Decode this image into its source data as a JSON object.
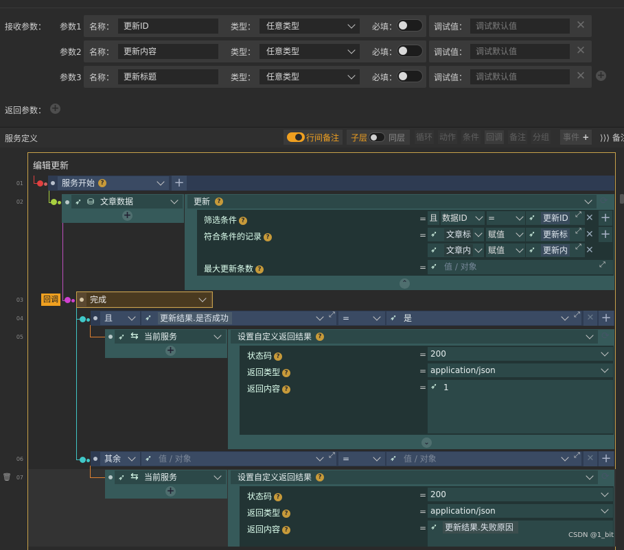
{
  "labels": {
    "receive": "接收参数：",
    "return": "返回参数：",
    "service_def": "服务定义"
  },
  "params": [
    {
      "idx": "参数1",
      "name_label": "名称：",
      "name": "更新ID",
      "type_label": "类型：",
      "type": "任意类型",
      "required_label": "必填：",
      "debug_label": "调试值：",
      "debug_ph": "调试默认值"
    },
    {
      "idx": "参数2",
      "name_label": "名称：",
      "name": "更新内容",
      "type_label": "类型：",
      "type": "任意类型",
      "required_label": "必填：",
      "debug_label": "调试值：",
      "debug_ph": "调试默认值"
    },
    {
      "idx": "参数3",
      "name_label": "名称：",
      "name": "更新标题",
      "type_label": "类型：",
      "type": "任意类型",
      "required_label": "必填：",
      "debug_label": "调试值：",
      "debug_ph": "调试默认值"
    }
  ],
  "toolbar": {
    "line_note": "行间备注",
    "child": "子层",
    "sibling": "同层",
    "loop": "循环",
    "action": "动作",
    "cond": "条件",
    "callback": "回调",
    "note": "备注",
    "group": "分组",
    "event": "事件",
    "note2": "备注"
  },
  "flow": {
    "title": "编辑更新",
    "lines": [
      "01",
      "02",
      "03",
      "04",
      "05",
      "06",
      "07"
    ],
    "start": "服务开始",
    "article": "文章数据",
    "update": "更新",
    "filter": "筛选条件",
    "filter_and": "且",
    "filter_field": "数据ID",
    "filter_op": "=",
    "filter_val": "更新ID",
    "records": "符合条件的记录",
    "rec1_field": "文章标",
    "rec1_op": "赋值",
    "rec1_val": "更新标",
    "rec2_field": "文章内",
    "rec2_op": "赋值",
    "rec2_val": "更新内",
    "maxcount": "最大更新条数",
    "value_ph": "值 / 对象",
    "callback_tag": "回调",
    "done": "完成",
    "and": "且",
    "cond_expr": "更新结果.是否成功",
    "eq": "=",
    "yes": "是",
    "cur_service": "当前服务",
    "set_result": "设置自定义返回结果",
    "status_code": "状态码",
    "status_val": "200",
    "ret_type": "返回类型",
    "ret_type_val": "application/json",
    "ret_content": "返回内容",
    "ret_content_val": "1",
    "else": "其余",
    "else_ph": "值 / 对象",
    "ret_content2": "更新结果.失败原因",
    "equals": "="
  },
  "watermark": "CSDN @1_bit",
  "colors": {
    "accent": "#f0a020",
    "frame": "#c9a24a",
    "start_dot": "#e04040",
    "green_dot": "#a8d040",
    "purple_dot": "#d040d0",
    "cyan_dot": "#40c8c8"
  }
}
